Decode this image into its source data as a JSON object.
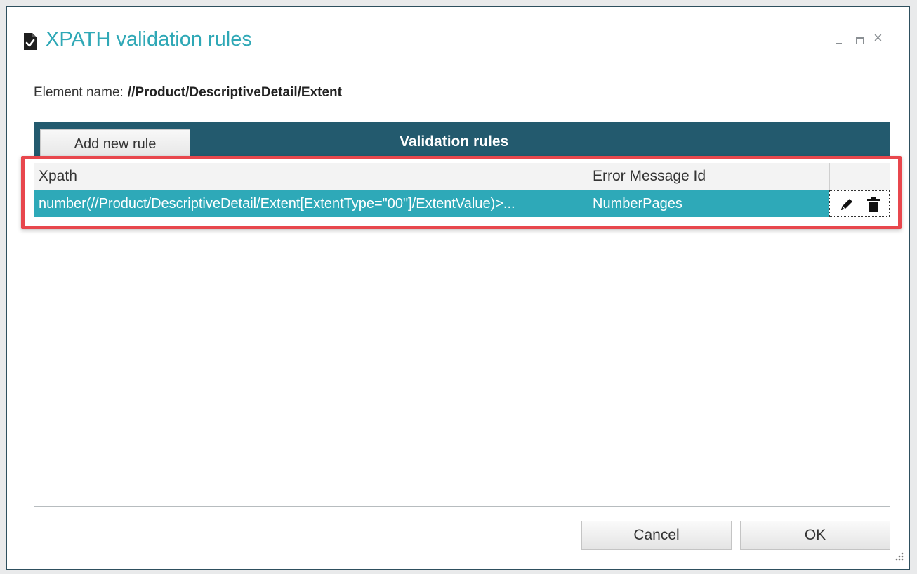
{
  "window": {
    "title": "XPATH validation rules",
    "controls": {
      "minimize": "minimize",
      "maximize": "maximize",
      "close": "×"
    }
  },
  "element": {
    "label": "Element name:",
    "value": "//Product/DescriptiveDetail/Extent"
  },
  "panel": {
    "add_button": "Add new rule",
    "title": "Validation rules",
    "columns": [
      "Xpath",
      "Error Message Id",
      ""
    ],
    "rows": [
      {
        "xpath": "number(//Product/DescriptiveDetail/Extent[ExtentType=\"00\"]/ExtentValue)>...",
        "error_message_id": "NumberPages"
      }
    ]
  },
  "buttons": {
    "cancel": "Cancel",
    "ok": "OK"
  },
  "colors": {
    "accent": "#2fa8b6",
    "header": "#235a6e",
    "selected_row": "#2ea9b8",
    "highlight": "#e8474d"
  },
  "icons": [
    "document-check-icon",
    "edit-pencil-icon",
    "trash-icon",
    "resize-grip-icon"
  ]
}
